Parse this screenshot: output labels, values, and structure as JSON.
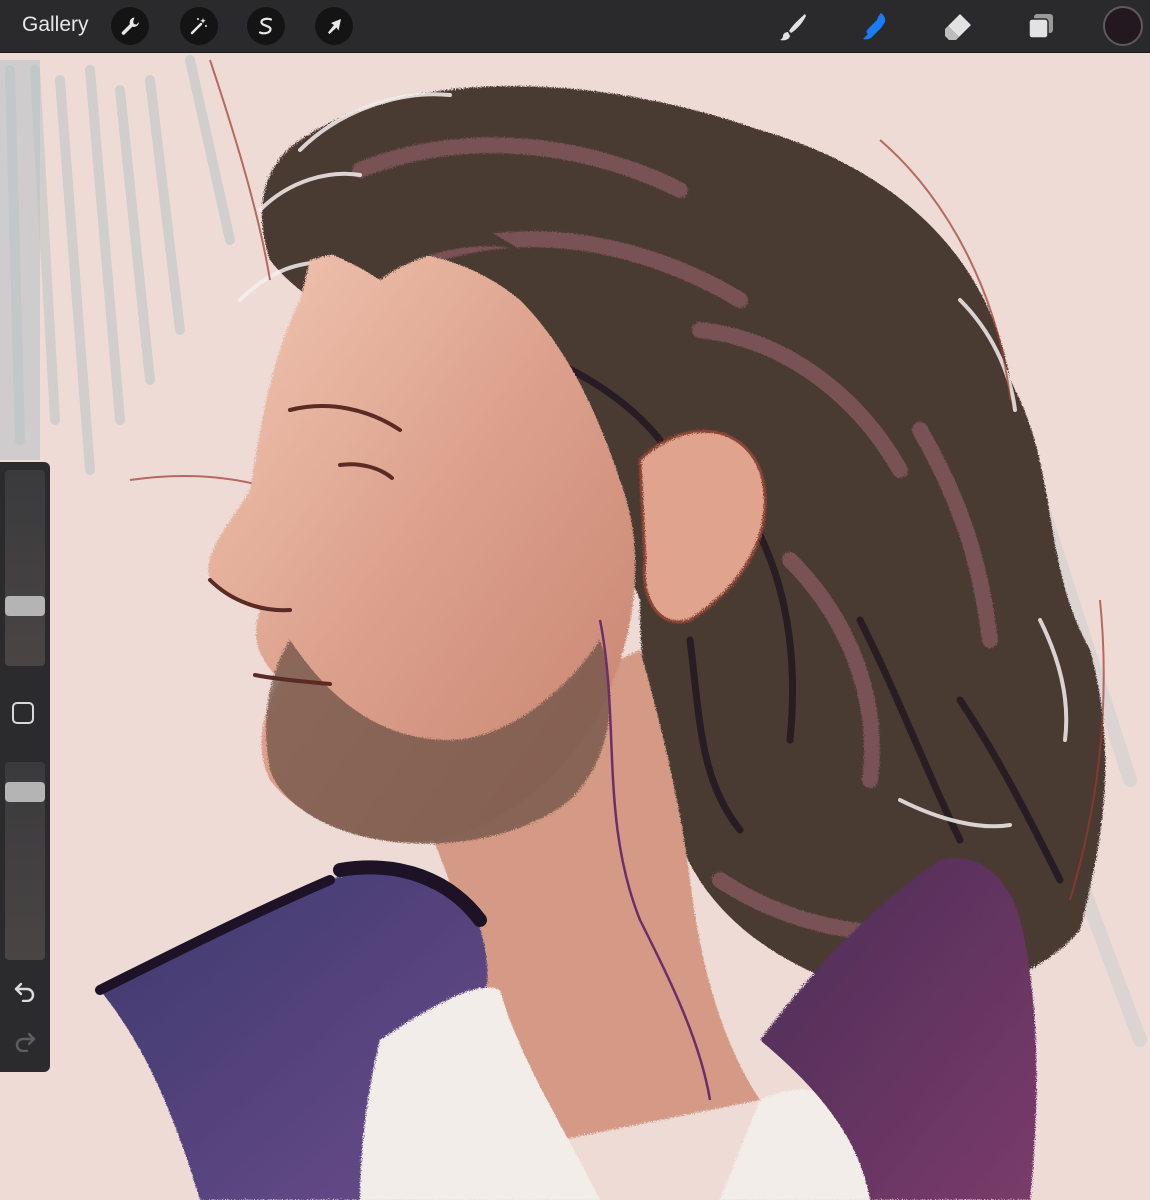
{
  "toolbar": {
    "gallery_label": "Gallery",
    "left_tools": [
      "wrench-icon",
      "magic-wand-icon",
      "selection-s-icon",
      "transform-arrow-icon"
    ],
    "right_tools": [
      "brush-icon",
      "smudge-icon",
      "eraser-icon",
      "layers-icon"
    ],
    "active_tool": "smudge",
    "active_tool_color": "#1a7cf5",
    "current_color": "#231820"
  },
  "sidebar": {
    "brush_size_level": 0.31,
    "opacity_level": 0.94,
    "buttons": [
      "modify-square-icon",
      "undo-icon",
      "redo-icon"
    ],
    "redo_enabled": false
  },
  "colors": {
    "toolbar_bg": "#2a2a2c",
    "canvas_bg": "#efdbd6",
    "hair": "#4a3a33",
    "skin": "#dba08c",
    "collar": "#5a3a78"
  }
}
